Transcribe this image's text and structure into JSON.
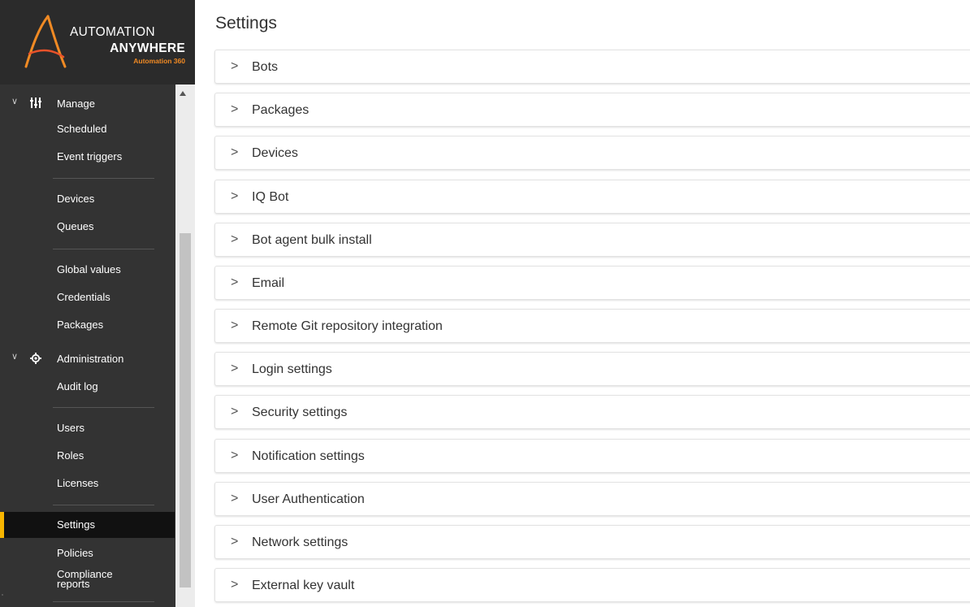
{
  "brand": {
    "line1": "AUTOMATION",
    "line2": "ANYWHERE",
    "tagline": "Automation 360",
    "accent": "#f08a24",
    "active_marker": "#f7b500"
  },
  "sidebar": {
    "manage": {
      "label": "Manage",
      "icon": "sliders-icon",
      "items": [
        {
          "label": "Scheduled"
        },
        {
          "label": "Event triggers"
        },
        {
          "label": "Devices"
        },
        {
          "label": "Queues"
        },
        {
          "label": "Global values"
        },
        {
          "label": "Credentials"
        },
        {
          "label": "Packages"
        }
      ]
    },
    "administration": {
      "label": "Administration",
      "icon": "gear-icon",
      "items": [
        {
          "label": "Audit log"
        },
        {
          "label": "Users"
        },
        {
          "label": "Roles"
        },
        {
          "label": "Licenses"
        },
        {
          "label": "Settings",
          "active": true
        },
        {
          "label": "Policies"
        },
        {
          "label": "Compliance\nreports"
        }
      ]
    }
  },
  "main": {
    "title": "Settings",
    "sections": [
      {
        "label": "Bots"
      },
      {
        "label": "Packages"
      },
      {
        "label": "Devices"
      },
      {
        "label": "IQ Bot"
      },
      {
        "label": "Bot agent bulk install"
      },
      {
        "label": "Email"
      },
      {
        "label": "Remote Git repository integration"
      },
      {
        "label": "Login settings"
      },
      {
        "label": "Security settings"
      },
      {
        "label": "Notification settings"
      },
      {
        "label": "User Authentication"
      },
      {
        "label": "Network settings"
      },
      {
        "label": "External key vault"
      }
    ]
  }
}
